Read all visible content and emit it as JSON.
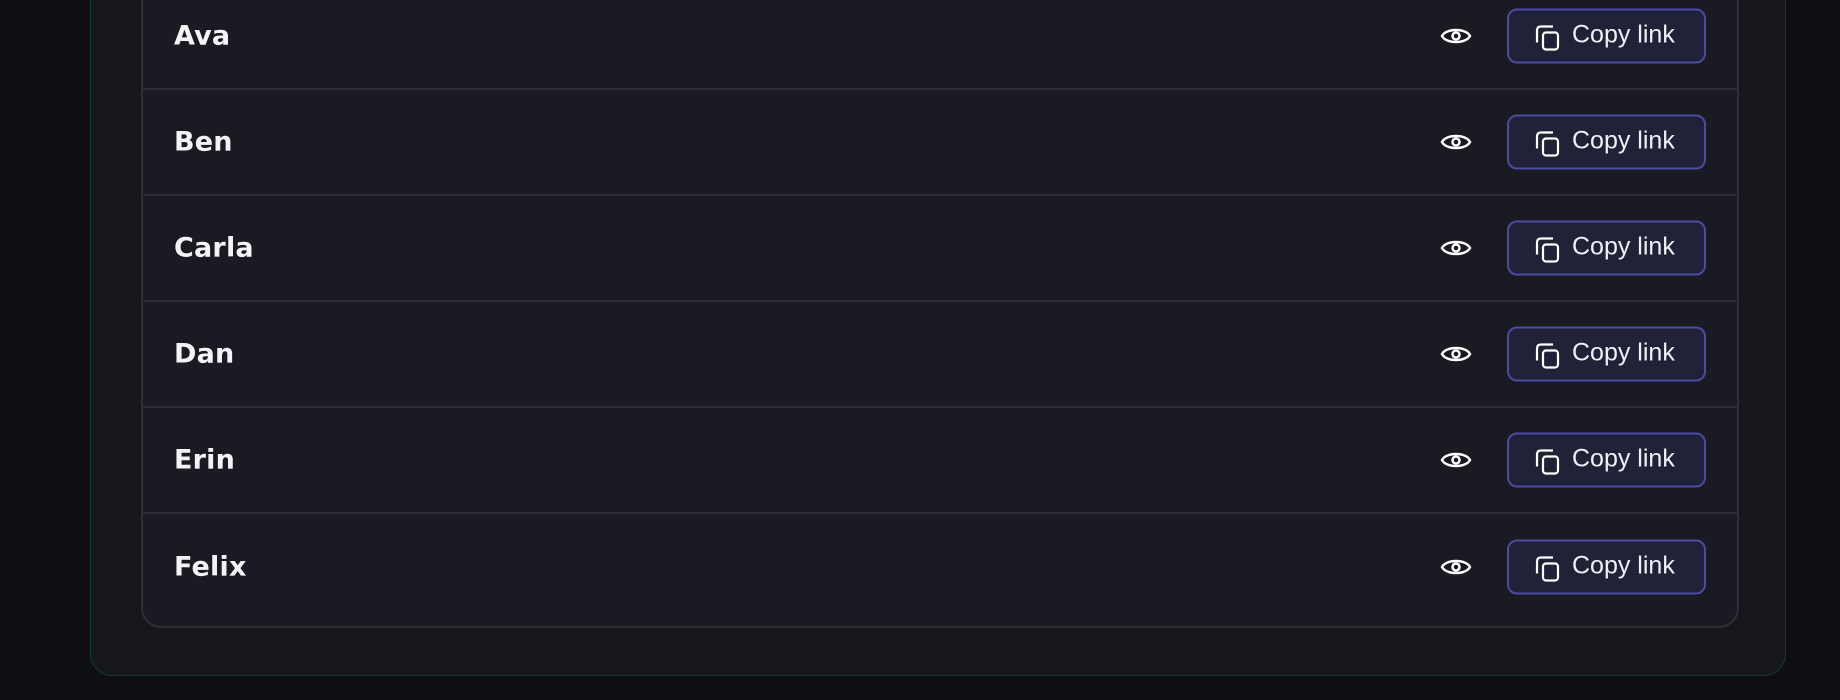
{
  "participants": [
    {
      "name": "Ava",
      "action_label": "Copy link"
    },
    {
      "name": "Ben",
      "action_label": "Copy link"
    },
    {
      "name": "Carla",
      "action_label": "Copy link"
    },
    {
      "name": "Dan",
      "action_label": "Copy link"
    },
    {
      "name": "Erin",
      "action_label": "Copy link"
    },
    {
      "name": "Felix",
      "action_label": "Copy link"
    }
  ],
  "icons": {
    "view": "eye-icon",
    "copy": "copy-icon"
  },
  "colors": {
    "page_background": "#0e0f13",
    "outer_border": "#123b2c",
    "list_background": "#1a1b22",
    "button_border": "#4b4ba6",
    "button_background": "#202237",
    "text": "#f3f4f7"
  }
}
